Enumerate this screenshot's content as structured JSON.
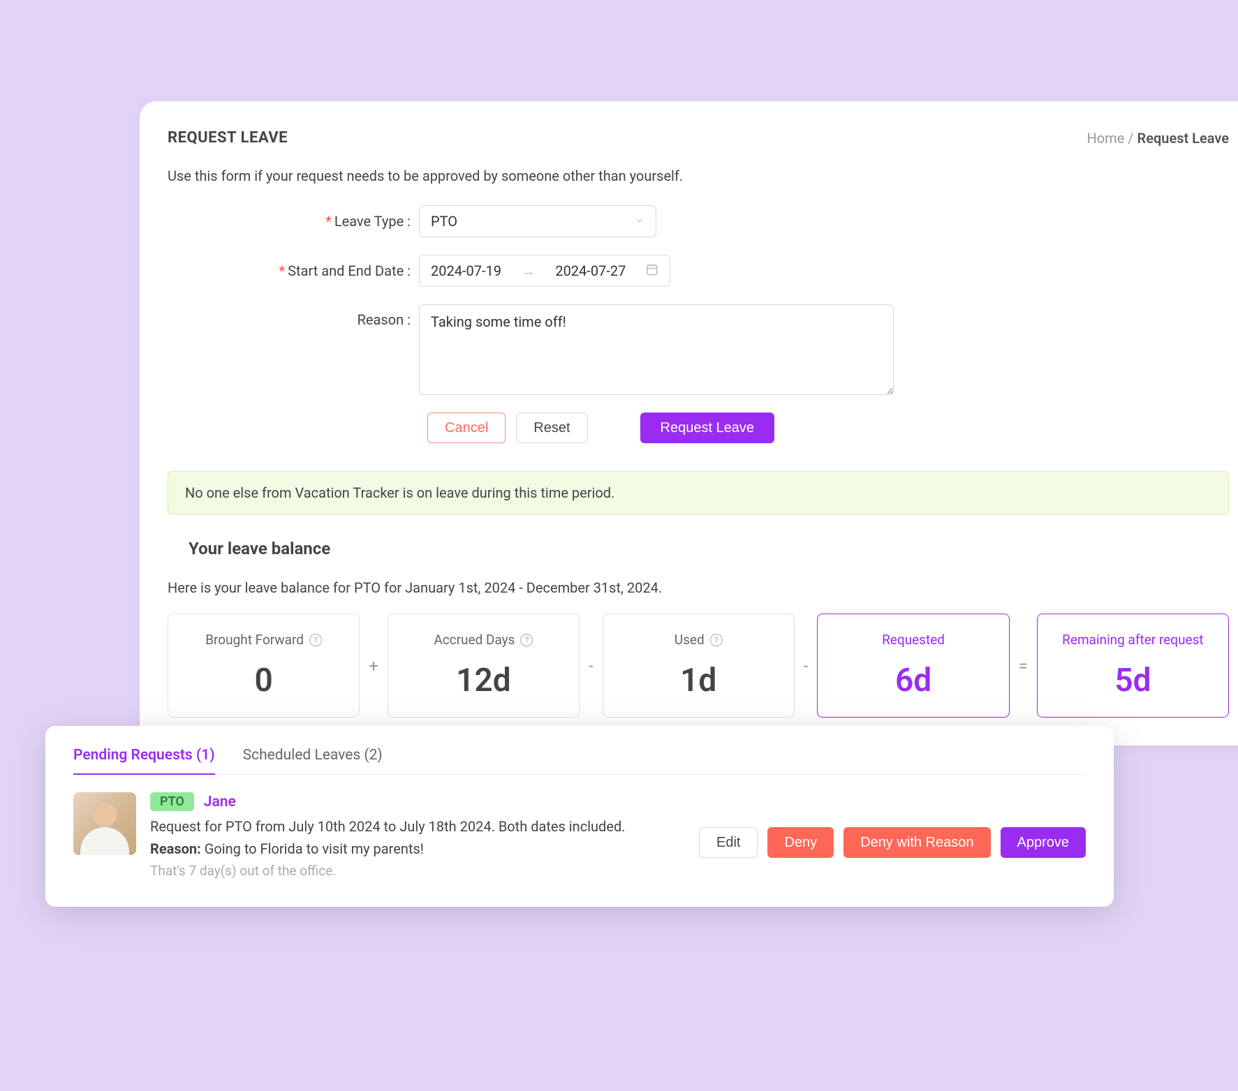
{
  "header": {
    "title": "REQUEST LEAVE",
    "breadcrumb_home": "Home",
    "breadcrumb_sep": "/",
    "breadcrumb_current": "Request Leave"
  },
  "form": {
    "description": "Use this form if your request needs to be approved by someone other than yourself.",
    "leave_type_label": "Leave Type :",
    "leave_type_value": "PTO",
    "date_label": "Start and End Date :",
    "start_date": "2024-07-19",
    "end_date": "2024-07-27",
    "reason_label": "Reason :",
    "reason_value": "Taking some time off!",
    "cancel_label": "Cancel",
    "reset_label": "Reset",
    "submit_label": "Request Leave"
  },
  "alert": {
    "message": "No one else from Vacation Tracker is on leave during this time period."
  },
  "balance": {
    "title": "Your leave balance",
    "description": "Here is your leave balance for PTO for January 1st, 2024 - December 31st, 2024.",
    "cards": {
      "brought_forward_label": "Brought Forward",
      "brought_forward_value": "0",
      "accrued_label": "Accrued Days",
      "accrued_value": "12d",
      "used_label": "Used",
      "used_value": "1d",
      "requested_label": "Requested",
      "requested_value": "6d",
      "remaining_label": "Remaining after request",
      "remaining_value": "5d"
    }
  },
  "pending": {
    "tab_pending": "Pending Requests (1)",
    "tab_scheduled": "Scheduled Leaves (2)",
    "badge": "PTO",
    "user_name": "Jane",
    "request_text": "Request for PTO from July 10th 2024 to July 18th 2024. Both dates included.",
    "reason_label": "Reason:",
    "reason_text": " Going to Florida to visit my parents!",
    "meta": "That's 7 day(s) out of the office.",
    "edit_label": "Edit",
    "deny_label": "Deny",
    "deny_reason_label": "Deny with Reason",
    "approve_label": "Approve"
  }
}
